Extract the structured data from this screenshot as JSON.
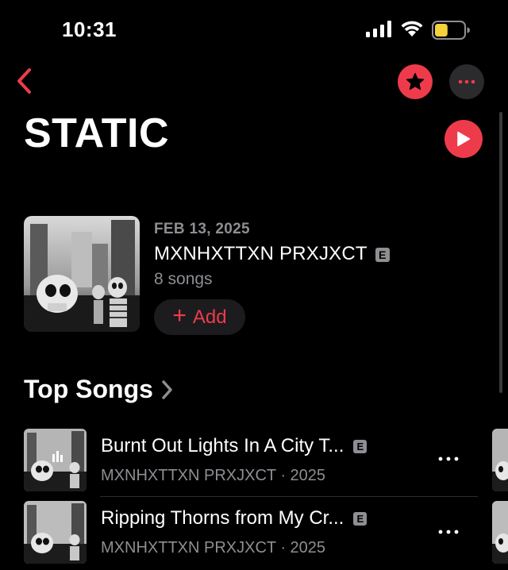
{
  "status_bar": {
    "time": "10:31"
  },
  "album": {
    "title": "STATIC",
    "date": "FEB 13, 2025",
    "artist": "MXNHXTTXN PRXJXCT",
    "explicit_badge": "E",
    "song_count": "8 songs",
    "add_plus": "+",
    "add_label": "Add"
  },
  "section": {
    "title": "Top Songs"
  },
  "songs": [
    {
      "title": "Burnt Out Lights In A City T...",
      "explicit": "E",
      "subtitle": "MXNHXTTXN PRXJXCT · 2025"
    },
    {
      "title": "Ripping Thorns from My Cr...",
      "explicit": "E",
      "subtitle": "MXNHXTTXN PRXJXCT · 2025"
    }
  ],
  "icons": {
    "back": "chevron-left-icon",
    "favorite": "star-icon",
    "more": "ellipsis-icon",
    "play": "play-icon",
    "section_chevron": "chevron-right-icon",
    "signal": "cellular-signal-icon",
    "wifi": "wifi-icon",
    "battery": "battery-icon"
  },
  "colors": {
    "accent": "#ee3b4b",
    "background": "#000000",
    "secondary_text": "#8e8e93",
    "battery_fill": "#f4d23c"
  },
  "battery_level": 0.45
}
